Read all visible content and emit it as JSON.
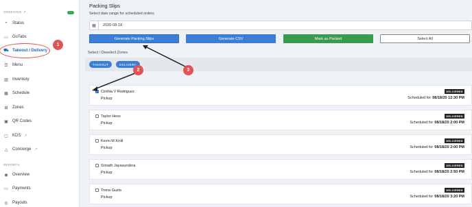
{
  "sidebar": {
    "ordering_label": "ORDERING",
    "reports_label": "REPORTS",
    "items": [
      {
        "label": "Status",
        "icon": "dot-icon"
      },
      {
        "label": "GoTabs",
        "icon": "tab-icon"
      },
      {
        "label": "Takeout / Delivery",
        "icon": "truck-icon"
      },
      {
        "label": "Menu",
        "icon": "menu-icon"
      },
      {
        "label": "Inventory",
        "icon": "chart-icon"
      },
      {
        "label": "Schedule",
        "icon": "calendar-icon"
      },
      {
        "label": "Zones",
        "icon": "grid-icon"
      },
      {
        "label": "QR Codes",
        "icon": "qr-icon"
      },
      {
        "label": "KDS",
        "icon": "monitor-icon"
      },
      {
        "label": "Concierge",
        "icon": "bell-icon"
      },
      {
        "label": "Overview",
        "icon": "eye-icon"
      },
      {
        "label": "Payments",
        "icon": "card-icon"
      },
      {
        "label": "Payouts",
        "icon": "money-icon"
      }
    ]
  },
  "annotations": [
    "1",
    "2",
    "3"
  ],
  "main": {
    "title": "Packing Slips",
    "subtitle": "Select date range for scheduled orders",
    "date_value": "2020-08-18",
    "buttons": {
      "generate_slips": "Generate Packing Slips",
      "generate_csv": "Generate CSV",
      "mark_packed": "Mark as Packed",
      "select_all": "Select All"
    },
    "zones_label": "Select / Deselect Zones",
    "zones": [
      "TAKEOUT",
      "DELIVERY"
    ],
    "orders": [
      {
        "name": "Cinthia V Rodriguez",
        "type": "Pickup",
        "status": "DELIVERED",
        "sched_prefix": "Scheduled for",
        "sched_time": "08/18/20 12:30 PM",
        "checked": true
      },
      {
        "name": "Taylor Hess",
        "type": "Pickup",
        "status": "DELIVERED",
        "sched_prefix": "Scheduled for",
        "sched_time": "08/18/20 2:00 PM",
        "checked": false
      },
      {
        "name": "Kevin M Kroll",
        "type": "Pickup",
        "status": "DELIVERED",
        "sched_prefix": "Scheduled for",
        "sched_time": "08/18/20 2:00 PM",
        "checked": false
      },
      {
        "name": "Srinath Jayasundera",
        "type": "Pickup",
        "status": "DELIVERED",
        "sched_prefix": "Scheduled for",
        "sched_time": "08/18/20 2:50 PM",
        "checked": false
      },
      {
        "name": "Trena Guzts",
        "type": "Pickup",
        "status": "DELIVERED",
        "sched_prefix": "Scheduled for",
        "sched_time": "08/18/20 3:20 PM",
        "checked": false
      }
    ]
  },
  "colors": {
    "accent": "#3a7fd5",
    "success": "#3a9a4d",
    "annotation": "#e05454"
  }
}
